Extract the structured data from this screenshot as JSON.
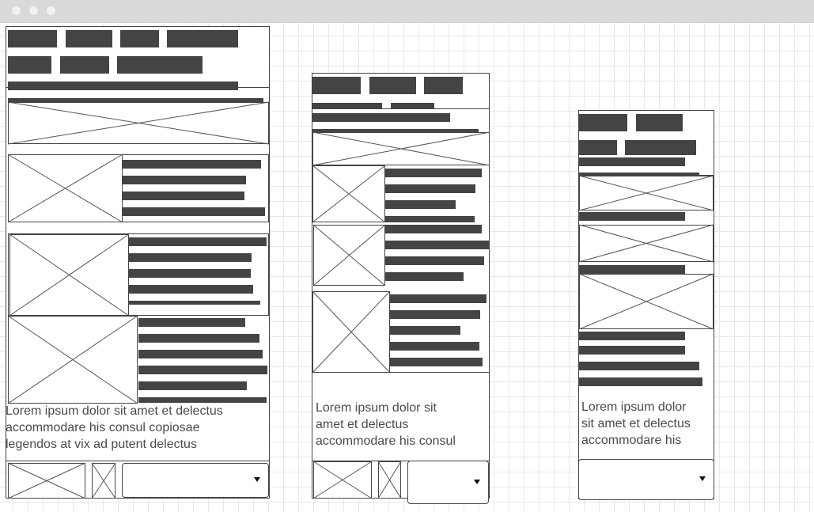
{
  "colors": {
    "titlebar": "#d9d9d9",
    "window_dots": "#f1f1f1",
    "grid_line": "#e8e8e8",
    "bar_fill": "#444444",
    "outline": "#444444",
    "lorem_text": "#4a4a4a"
  },
  "wireframes": {
    "desktop": {
      "lorem": "Lorem ipsum dolor sit amet et delectus accommodare his consul copiosae legendos at vix ad putent delectus",
      "lorem_lines": [
        "Lorem ipsum dolor sit amet et delectus",
        "accommodare his consul copiosae",
        "legendos at vix ad putent delectus"
      ]
    },
    "tablet": {
      "lorem_lines": [
        "Lorem ipsum dolor sit",
        "amet et delectus",
        "accommodare his consul"
      ]
    },
    "mobile": {
      "lorem_lines": [
        "Lorem ipsum dolor",
        "sit amet et delectus",
        "accommodare his"
      ]
    }
  },
  "icons": {
    "placeholder": "image-placeholder-icon",
    "dropdown": "caret-down-icon"
  }
}
